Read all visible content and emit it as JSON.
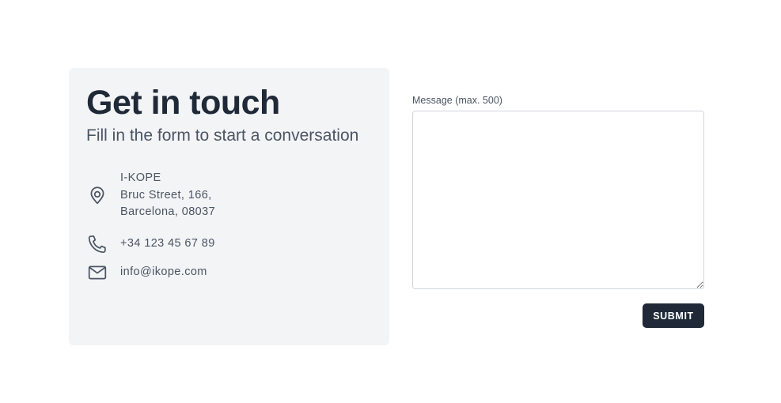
{
  "info": {
    "title": "Get in touch",
    "subtitle": "Fill in the form to start a conversation",
    "address": {
      "icon": "map-pin-icon",
      "line1": "I-KOPE",
      "line2": "Bruc Street, 166,",
      "line3": "Barcelona, 08037"
    },
    "phone": {
      "icon": "phone-icon",
      "value": "+34 123 45 67 89"
    },
    "email": {
      "icon": "mail-icon",
      "value": "info@ikope.com"
    }
  },
  "form": {
    "message_label": "Message (max. 500)",
    "message_value": "",
    "submit_label": "SUBMIT"
  },
  "colors": {
    "card_background": "#f3f4f6",
    "heading": "#1f2937",
    "muted_text": "#4b5563",
    "button_background": "#1f2937",
    "button_text": "#ffffff",
    "input_border": "#d1d5db"
  }
}
